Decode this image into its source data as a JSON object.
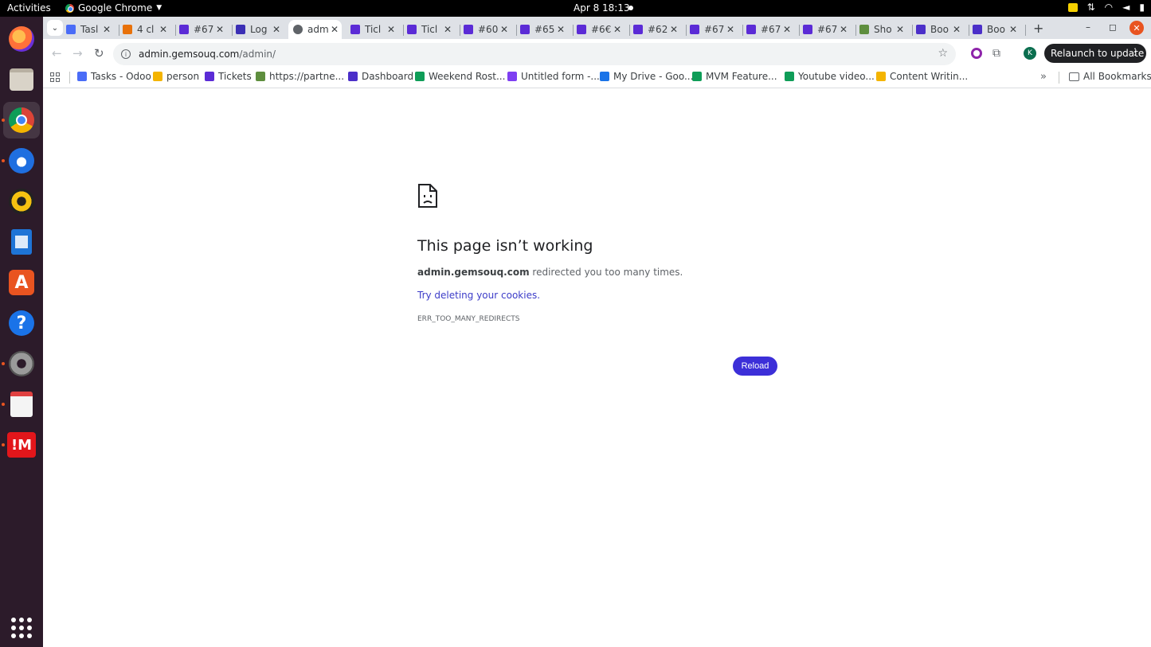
{
  "topbar": {
    "activities": "Activities",
    "app_name": "Google Chrome",
    "clock": "Apr 8  18:13"
  },
  "tabs": [
    {
      "label": "Tasl",
      "favicon_color": "#4a6cf7"
    },
    {
      "label": "4 cl",
      "favicon_color": "#e8710a"
    },
    {
      "label": "#67",
      "favicon_color": "#5b2bd6"
    },
    {
      "label": "Log",
      "favicon_color": "#3b2fb5"
    },
    {
      "label": "adm",
      "favicon_color": "#5f6368"
    },
    {
      "label": "Ticl",
      "favicon_color": "#5b2bd6"
    },
    {
      "label": "Ticl",
      "favicon_color": "#5b2bd6"
    },
    {
      "label": "#60",
      "favicon_color": "#5b2bd6"
    },
    {
      "label": "#65",
      "favicon_color": "#5b2bd6"
    },
    {
      "label": "#6€",
      "favicon_color": "#5b2bd6"
    },
    {
      "label": "#62",
      "favicon_color": "#5b2bd6"
    },
    {
      "label": "#67",
      "favicon_color": "#5b2bd6"
    },
    {
      "label": "#67",
      "favicon_color": "#5b2bd6"
    },
    {
      "label": "#67",
      "favicon_color": "#5b2bd6"
    },
    {
      "label": "Sho",
      "favicon_color": "#5e8e3e"
    },
    {
      "label": "Boo",
      "favicon_color": "#4b2fc9"
    },
    {
      "label": "Boo",
      "favicon_color": "#4b2fc9"
    }
  ],
  "omnibox": {
    "host": "admin.gemsouq.com",
    "path": "/admin/"
  },
  "toolbar": {
    "profile_initial": "K",
    "relaunch_label": "Relaunch to update"
  },
  "bookmarks": [
    {
      "label": "Tasks - Odoo",
      "color": "#4a6cf7"
    },
    {
      "label": "person",
      "color": "#f4b400"
    },
    {
      "label": "Tickets",
      "color": "#5b2bd6"
    },
    {
      "label": "https://partne...",
      "color": "#5e8e3e"
    },
    {
      "label": "Dashboard",
      "color": "#4b2fc9"
    },
    {
      "label": "Weekend Rost...",
      "color": "#0f9d58"
    },
    {
      "label": "Untitled form -...",
      "color": "#7e3ff2"
    },
    {
      "label": "My Drive - Goo...",
      "color": "#1a73e8"
    },
    {
      "label": "MVM Feature...",
      "color": "#0f9d58"
    },
    {
      "label": "Youtube video...",
      "color": "#0f9d58"
    },
    {
      "label": "Content Writin...",
      "color": "#f4b400"
    }
  ],
  "all_bookmarks": "All Bookmarks",
  "error": {
    "title": "This page isn’t working",
    "host": "admin.gemsouq.com",
    "message_rest": " redirected you too many times.",
    "suggestion": "Try deleting your cookies.",
    "code": "ERR_TOO_MANY_REDIRECTS",
    "reload_label": "Reload"
  }
}
